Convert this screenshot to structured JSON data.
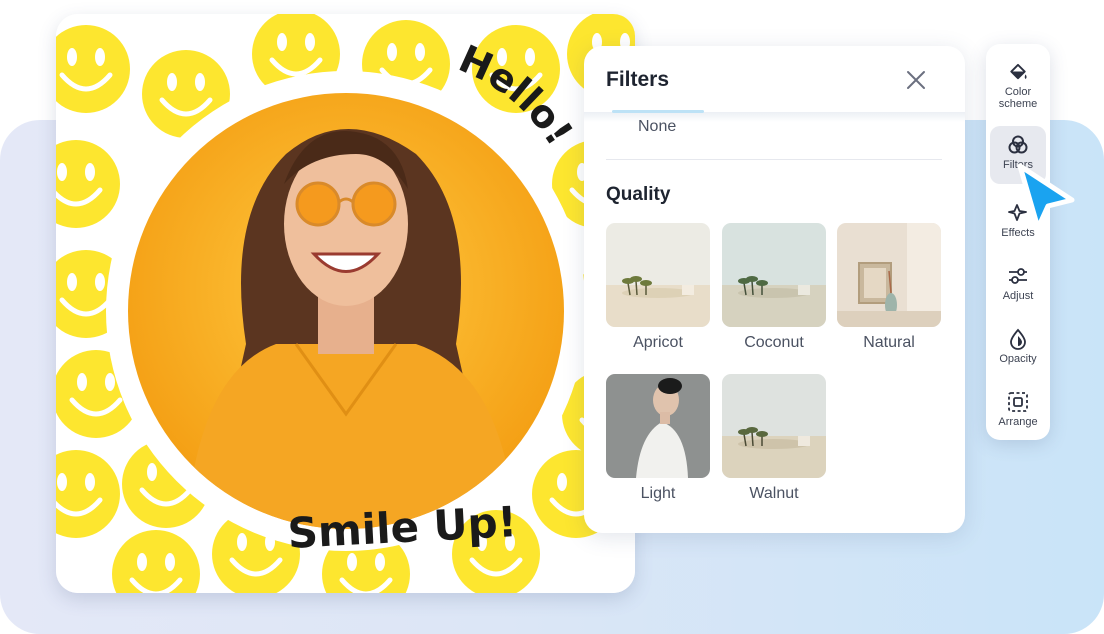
{
  "canvas": {
    "greeting_text": "Hello!",
    "slogan_text": "Smile Up!",
    "colors": {
      "smiley": "#fde62f",
      "circle": "#f7a11a",
      "sweater": "#f5a623"
    }
  },
  "filters_panel": {
    "title": "Filters",
    "close_icon": "close-icon",
    "none_label": "None",
    "section_title": "Quality",
    "items": [
      {
        "label": "Apricot"
      },
      {
        "label": "Coconut"
      },
      {
        "label": "Natural"
      },
      {
        "label": "Light"
      },
      {
        "label": "Walnut"
      }
    ]
  },
  "toolbar": {
    "items": [
      {
        "label": "Color scheme",
        "icon": "paint-bucket-icon"
      },
      {
        "label": "Filters",
        "icon": "filters-icon",
        "active": true
      },
      {
        "label": "Effects",
        "icon": "sparkle-icon"
      },
      {
        "label": "Adjust",
        "icon": "sliders-icon"
      },
      {
        "label": "Opacity",
        "icon": "droplet-icon"
      },
      {
        "label": "Arrange",
        "icon": "arrange-icon"
      }
    ],
    "accent": "#1aa3f0"
  }
}
